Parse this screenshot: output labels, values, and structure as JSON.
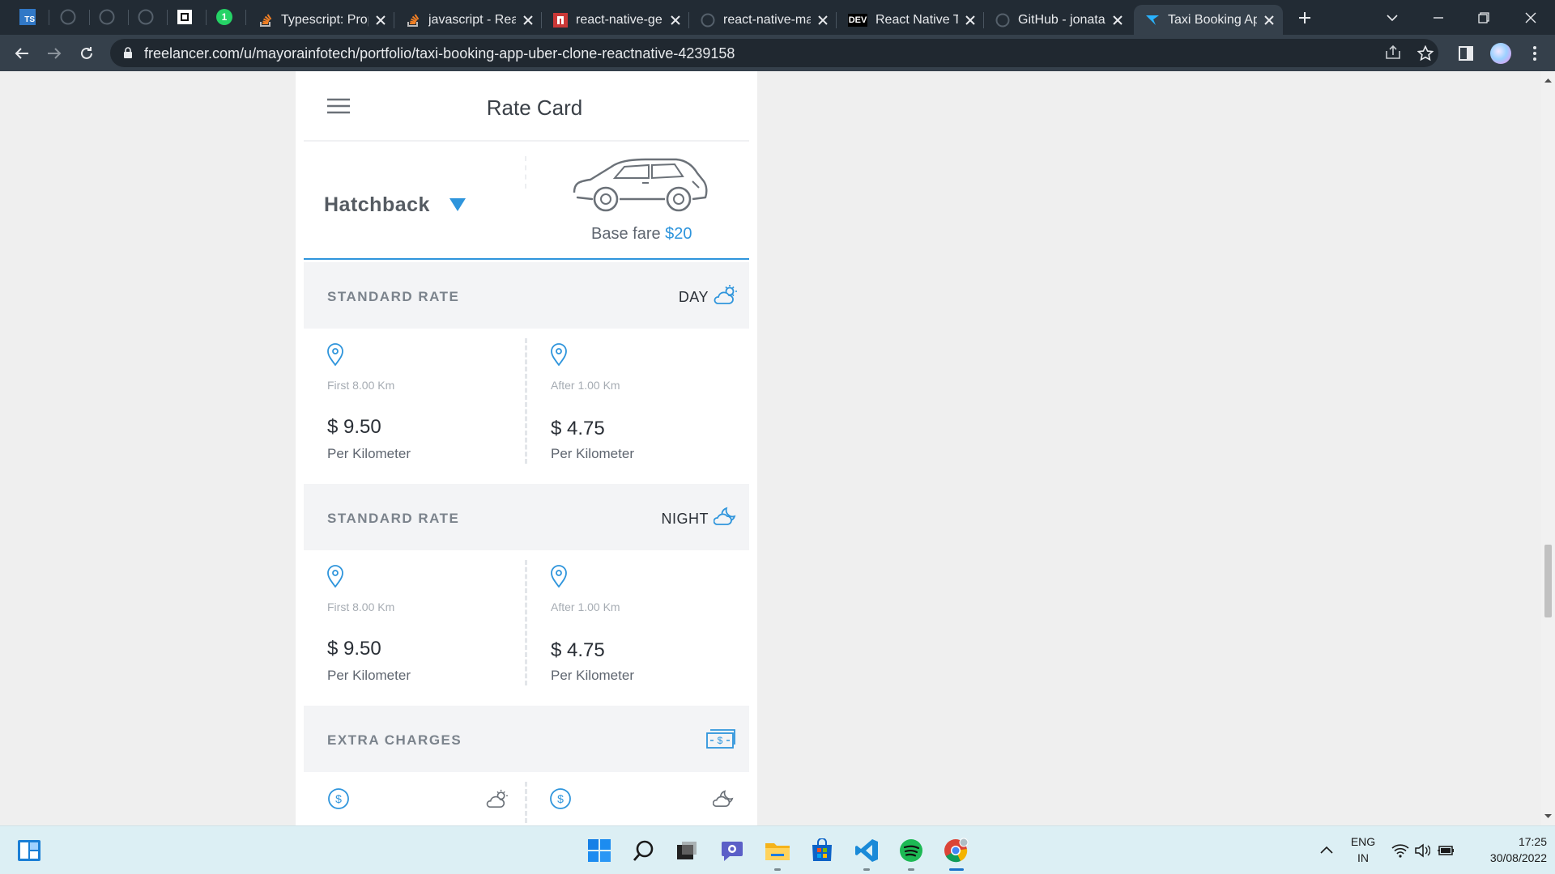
{
  "browser": {
    "tabs": [
      {
        "title": "Typescript: Prop",
        "favicon": "stackoverflow-icon"
      },
      {
        "title": "javascript - Rea",
        "favicon": "stackoverflow-icon"
      },
      {
        "title": "react-native-ge",
        "favicon": "npm-icon"
      },
      {
        "title": "react-native-ma",
        "favicon": "github-icon"
      },
      {
        "title": "React Native Ta",
        "favicon": "dev-icon"
      },
      {
        "title": "GitHub - jonata",
        "favicon": "github-icon"
      },
      {
        "title": "Taxi Booking Ap",
        "favicon": "freelancer-icon",
        "active": true
      }
    ],
    "pinned": [
      "ts-icon",
      "github-icon",
      "github-icon",
      "github-icon",
      "notion-icon",
      "whatsapp-icon"
    ],
    "whatsapp_badge": "1",
    "dev_label": "DEV",
    "ts_label": "TS",
    "url": "freelancer.com/u/mayorainfotech/portfolio/taxi-booking-app-uber-clone-reactnative-4239158"
  },
  "app": {
    "title": "Rate Card",
    "vehicle": {
      "selected": "Hatchback",
      "base_fare_label": "Base fare",
      "base_fare_value": "$20"
    },
    "sections": [
      {
        "heading": "STANDARD RATE",
        "period": "DAY",
        "period_icon": "sun-cloud-icon",
        "cells": [
          {
            "distance": "First 8.00 Km",
            "price": "$ 9.50",
            "unit": "Per Kilometer"
          },
          {
            "distance": "After 1.00 Km",
            "price": "$ 4.75",
            "unit": "Per Kilometer"
          }
        ]
      },
      {
        "heading": "STANDARD RATE",
        "period": "NIGHT",
        "period_icon": "moon-cloud-icon",
        "cells": [
          {
            "distance": "First 8.00 Km",
            "price": "$ 9.50",
            "unit": "Per Kilometer"
          },
          {
            "distance": "After 1.00 Km",
            "price": "$ 4.75",
            "unit": "Per Kilometer"
          }
        ]
      },
      {
        "heading": "EXTRA CHARGES",
        "period_icon": "cash-icon"
      }
    ],
    "accent": "#2f95dc"
  },
  "taskbar": {
    "apps": [
      "widgets-icon",
      "start-icon",
      "search-icon",
      "task-view-icon",
      "teams-chat-icon",
      "file-explorer-icon",
      "store-icon",
      "vscode-icon",
      "spotify-icon",
      "chrome-icon"
    ],
    "lang_top": "ENG",
    "lang_bottom": "IN",
    "time": "17:25",
    "date": "30/08/2022"
  }
}
